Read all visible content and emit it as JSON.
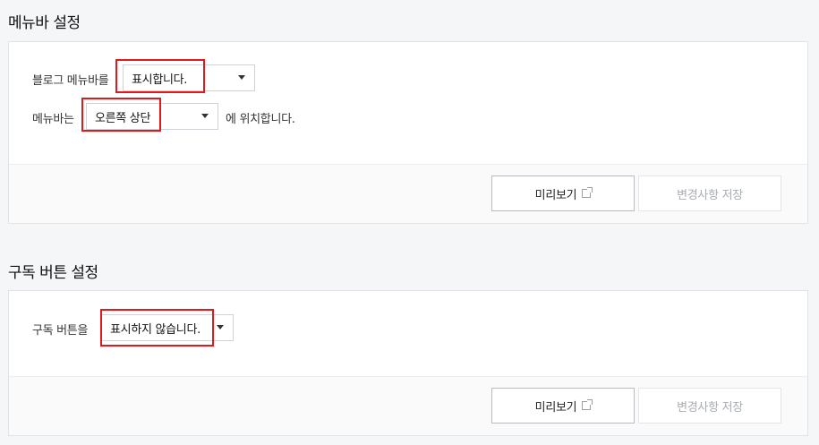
{
  "menubar": {
    "title": "메뉴바 설정",
    "row1_label": "블로그 메뉴바를",
    "row1_select": "표시합니다.",
    "row2_label": "메뉴바는",
    "row2_select": "오른쪽 상단",
    "row2_suffix": "에 위치합니다.",
    "preview_label": "미리보기",
    "save_label": "변경사항 저장"
  },
  "subscribe": {
    "title": "구독 버튼 설정",
    "row1_label": "구독 버튼을",
    "row1_select": "표시하지 않습니다.",
    "preview_label": "미리보기",
    "save_label": "변경사항 저장"
  },
  "colors": {
    "highlight": "#e0191f",
    "page_background": "#f5f6f7"
  },
  "icons": {
    "dropdown": "caret-down-icon",
    "preview": "external-link-icon"
  }
}
